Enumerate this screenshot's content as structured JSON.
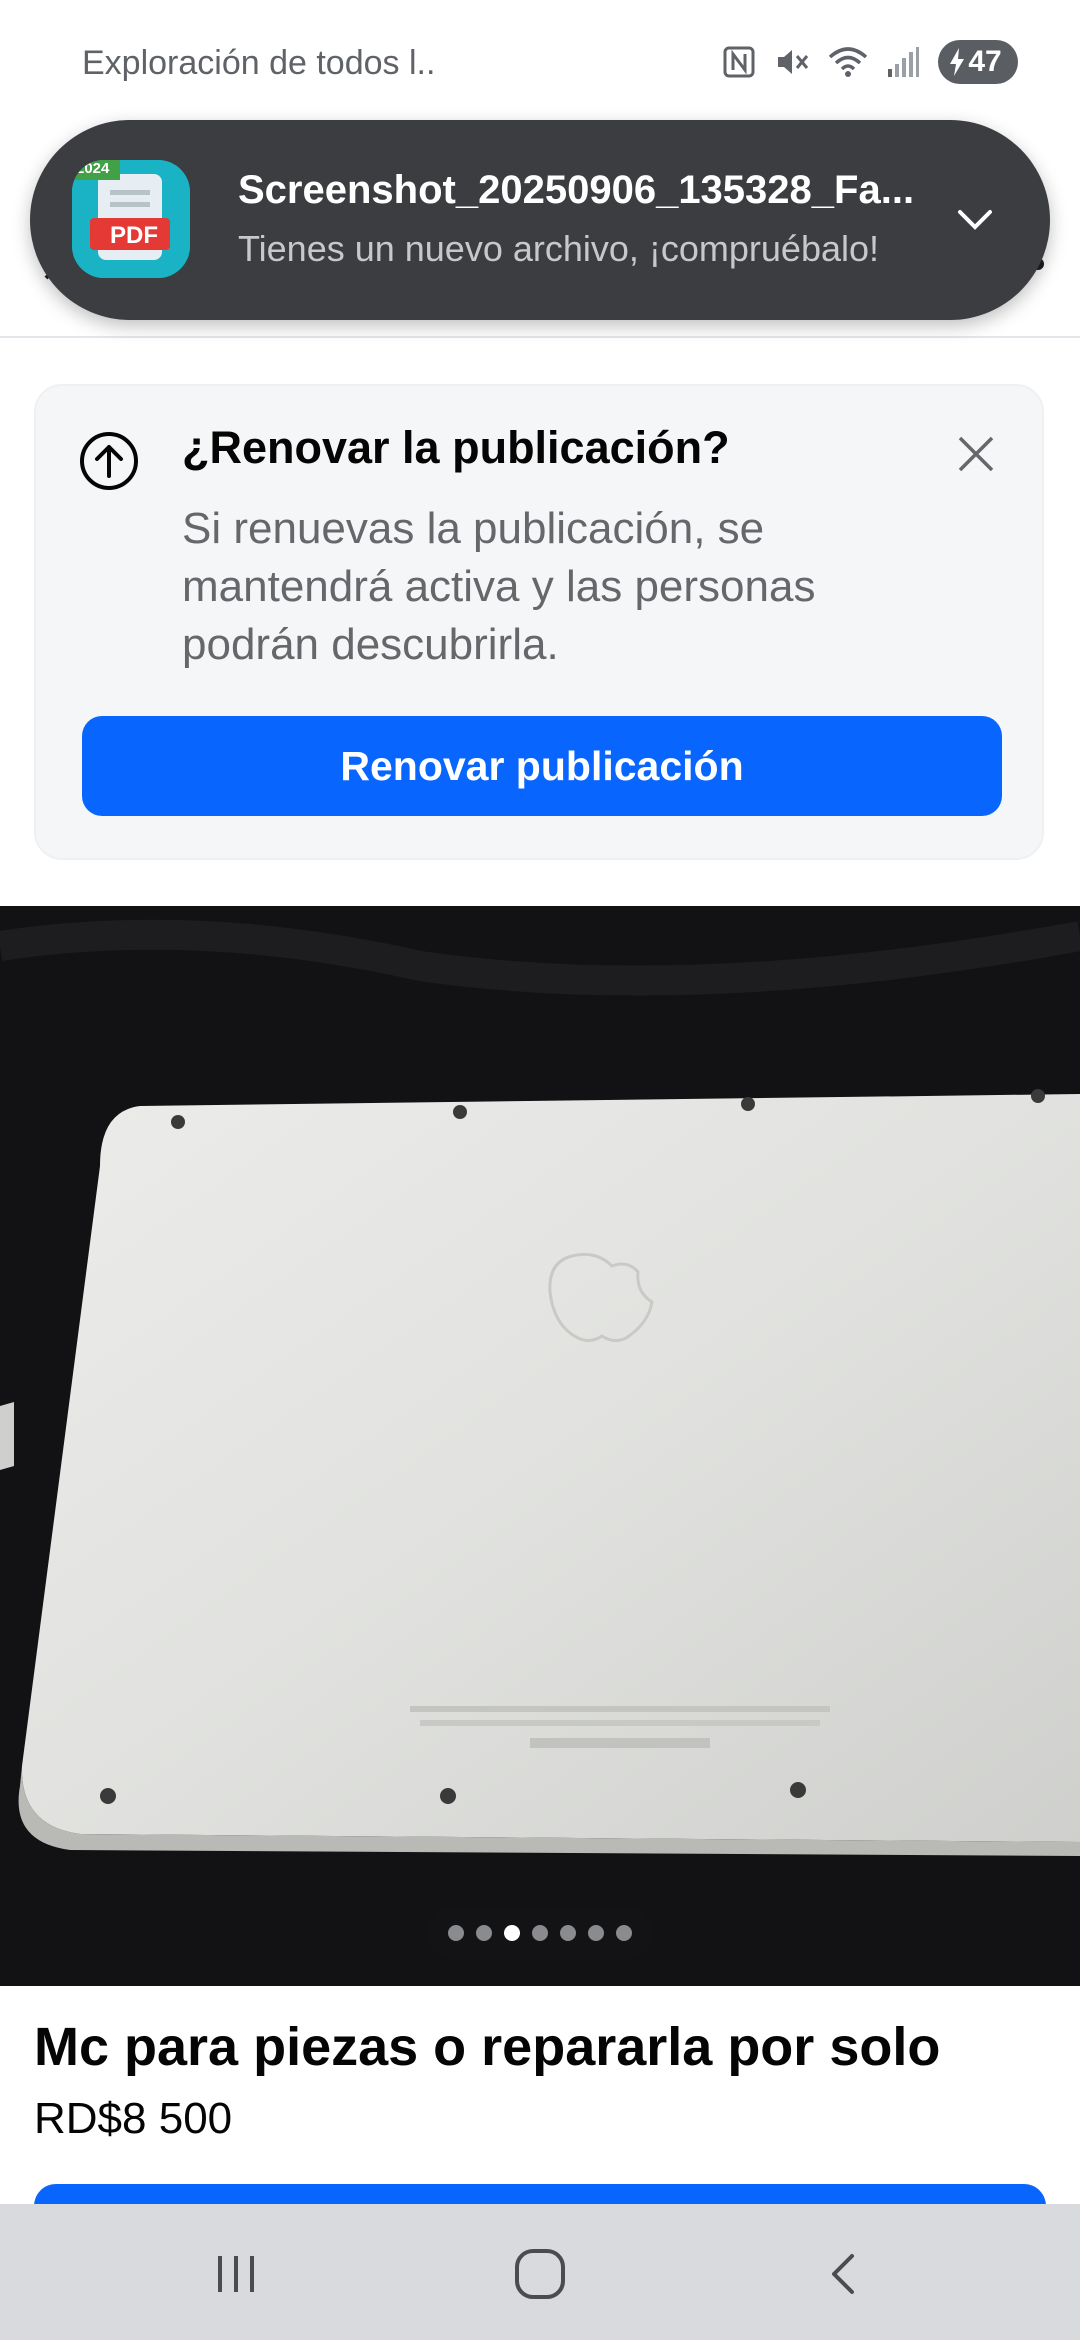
{
  "status_bar": {
    "left_text": "Exploración de todos l..",
    "battery_level": "47",
    "icons": [
      "nfc-icon",
      "mute-icon",
      "wifi-icon",
      "signal-icon",
      "battery-charging-icon"
    ]
  },
  "notification": {
    "app_icon": "pdf-app-icon",
    "app_icon_badge": "2024",
    "app_icon_label": "PDF",
    "title": "Screenshot_20250906_135328_Fa...",
    "body": "Tienes un nuevo archivo, ¡compruébalo!",
    "expand_icon": "chevron-down-icon"
  },
  "renew_card": {
    "icon": "arrow-up-circle-icon",
    "title": "¿Renovar la publicación?",
    "description": "Si renuevas la publicación, se mantendrá activa y las personas podrán descubrirla.",
    "close_icon": "close-icon",
    "button_label": "Renovar publicación"
  },
  "photo": {
    "subject": "laptop-bottom-case-photo",
    "pager_total": 7,
    "pager_active_index": 2
  },
  "listing": {
    "title": "Mc para piezas o repararla por solo",
    "price": "RD$8 500"
  },
  "nav_bar": {
    "icons": [
      "recents-icon",
      "home-icon",
      "back-icon"
    ]
  },
  "colors": {
    "accent": "#0866ff",
    "notification_bg": "#3c3d40",
    "card_bg": "#f5f6f7",
    "nav_bg": "#d8dade"
  }
}
